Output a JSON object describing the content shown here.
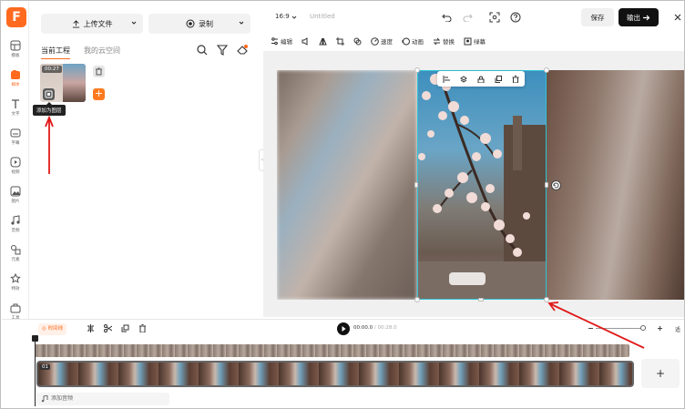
{
  "app": {
    "logo_letter": "F",
    "accent": "#ff6a1f"
  },
  "sidebar": {
    "items": [
      {
        "label": "模板",
        "icon": "template-icon"
      },
      {
        "label": "媒体",
        "icon": "media-icon",
        "active": true
      },
      {
        "label": "文字",
        "icon": "text-icon"
      },
      {
        "label": "字幕",
        "icon": "subtitle-icon"
      },
      {
        "label": "视频",
        "icon": "video-icon"
      },
      {
        "label": "图片",
        "icon": "image-icon"
      },
      {
        "label": "音频",
        "icon": "audio-icon"
      },
      {
        "label": "元素",
        "icon": "elements-icon"
      },
      {
        "label": "特效",
        "icon": "effects-icon"
      },
      {
        "label": "工具",
        "icon": "tools-icon"
      }
    ]
  },
  "media_panel": {
    "upload_label": "上传文件",
    "record_label": "录制",
    "tabs": [
      "当前工程",
      "我的云空间"
    ],
    "thumb_duration": "00:27",
    "add_to_layer_tooltip": "添加为图层"
  },
  "header": {
    "aspect_ratio": "16:9",
    "project_title": "Untitled",
    "save_label": "保存",
    "export_label": "输出"
  },
  "edit_toolbar": {
    "items": [
      "编辑",
      "",
      "",
      "",
      "",
      "速度",
      "动画",
      "替换",
      "绿幕"
    ]
  },
  "timeline": {
    "mode_label": "时间线",
    "current_time": "00:00.0",
    "total_time": "00:28.0",
    "track_index": "01",
    "add_audio_label": "添加音频",
    "fit_label": "适"
  }
}
